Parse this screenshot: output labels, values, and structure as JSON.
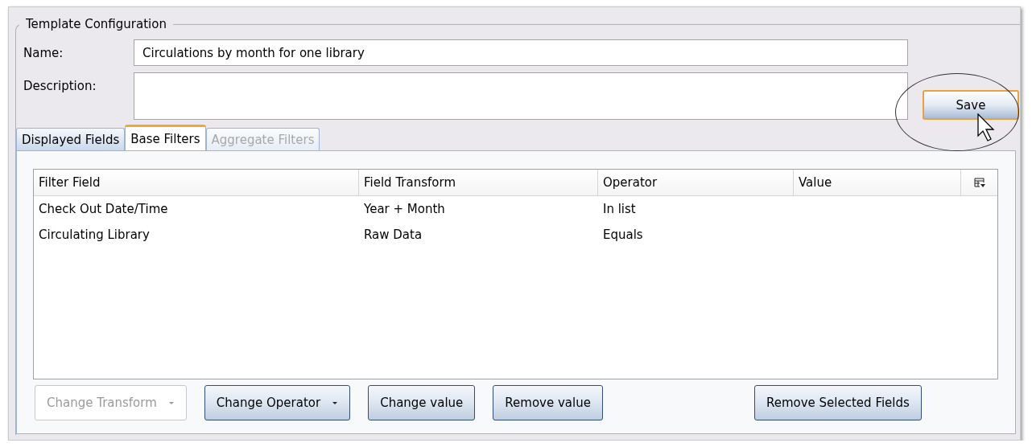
{
  "group": {
    "legend": "Template Configuration"
  },
  "fields": [
    {
      "kind": "line",
      "label": "Name:",
      "value": "Circulations by month for one library"
    },
    {
      "kind": "area",
      "label": "Description:"
    }
  ],
  "save_button": {
    "label": "Save"
  },
  "tabs": [
    {
      "label": "Displayed Fields",
      "selected": false,
      "disabled": false
    },
    {
      "label": "Base Filters",
      "selected": true,
      "disabled": false
    },
    {
      "label": "Aggregate Filters",
      "selected": false,
      "disabled": true
    }
  ],
  "table": {
    "columns": [
      "Filter Field",
      "Field Transform",
      "Operator",
      "Value"
    ],
    "rows": [
      [
        "Check Out Date/Time",
        "Year + Month",
        "In list",
        ""
      ],
      [
        "Circulating Library",
        "Raw Data",
        "Equals",
        ""
      ]
    ]
  },
  "buttons": [
    {
      "label": "Change Transform",
      "disabled": true,
      "menu": true
    },
    {
      "label": "Change Operator",
      "disabled": false,
      "menu": true
    },
    {
      "label": "Change value",
      "disabled": false,
      "menu": false
    },
    {
      "label": "Remove value",
      "disabled": false,
      "menu": false
    },
    {
      "label": "Remove Selected Fields",
      "disabled": false,
      "menu": false
    }
  ]
}
